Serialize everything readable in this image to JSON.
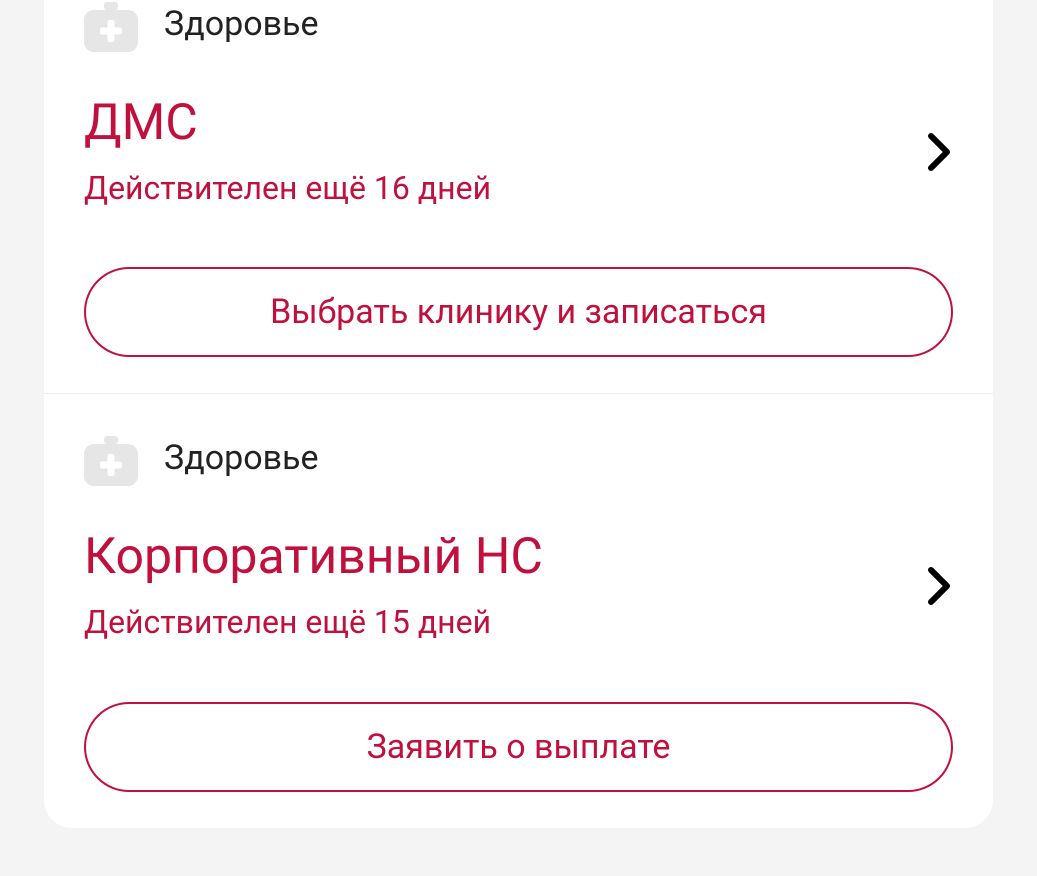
{
  "policies": [
    {
      "category": "Здоровье",
      "title": "ДМС",
      "subtitle": "Действителен ещё 16 дней",
      "action": "Выбрать клинику и записаться"
    },
    {
      "category": "Здоровье",
      "title": "Корпоративный НС",
      "subtitle": "Действителен ещё 15 дней",
      "action": "Заявить о выплате"
    }
  ],
  "colors": {
    "accent": "#c0113e",
    "icon_bg": "#e6e6e6"
  }
}
